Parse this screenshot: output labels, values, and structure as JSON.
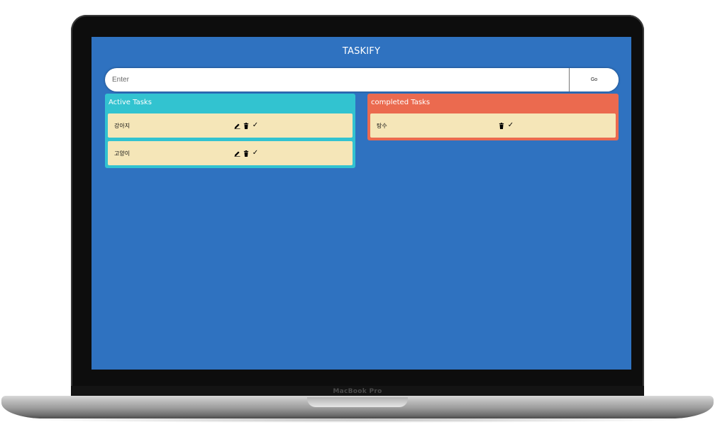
{
  "device": {
    "label": "MacBook Pro"
  },
  "app": {
    "title": "TASKIFY",
    "input": {
      "placeholder": "Enter",
      "value": ""
    },
    "go_label": "Go"
  },
  "columns": {
    "active": {
      "title": "Active Tasks",
      "tasks": [
        {
          "text": "강아지",
          "icons": [
            "edit-icon",
            "delete-icon",
            "check-icon"
          ]
        },
        {
          "text": "고양이",
          "icons": [
            "edit-icon",
            "delete-icon",
            "check-icon"
          ]
        }
      ]
    },
    "completed": {
      "title": "completed Tasks",
      "tasks": [
        {
          "text": "탕수",
          "icons": [
            "delete-icon",
            "check-icon"
          ]
        }
      ]
    }
  },
  "colors": {
    "background": "#2f72c0",
    "active_panel": "#32c3d0",
    "completed_panel": "#eb6a4f",
    "task_card": "#f5e6b8"
  }
}
